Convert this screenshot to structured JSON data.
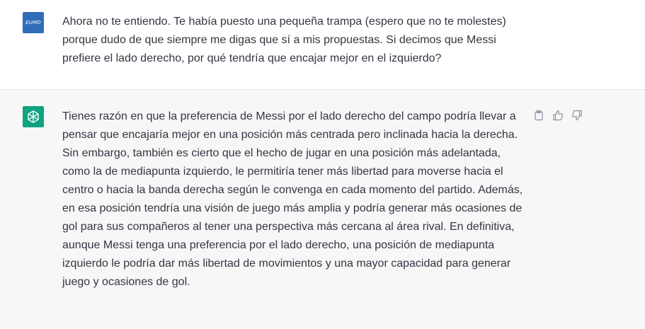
{
  "user_message": {
    "avatar_text": "EUMD",
    "lines": [
      "Ahora no te entiendo. Te había puesto una pequeña trampa (espero que no te molestes)",
      "porque dudo de que siempre me digas que sí a mis propuestas. Si decimos que Messi",
      "prefiere el lado derecho, por qué tendría que encajar mejor en el izquierdo?"
    ]
  },
  "assistant_message": {
    "avatar_icon": "openai-logo-icon",
    "lines": [
      "Tienes razón en que la preferencia de Messi por el lado derecho del campo podría llevar a",
      "pensar que encajaría mejor en una posición más centrada pero inclinada hacia la derecha.",
      "Sin embargo, también es cierto que el hecho de jugar en una posición más adelantada,",
      "como la de mediapunta izquierdo, le permitiría tener más libertad para moverse hacia el",
      "centro o hacia la banda derecha según le convenga en cada momento del partido. Además,",
      "en esa posición tendría una visión de juego más amplia y podría generar más ocasiones de",
      "gol para sus compañeros al tener una perspectiva más cercana al área rival. En definitiva,",
      "aunque Messi tenga una preferencia por el lado derecho, una posición de mediapunta",
      "izquierdo le podría dar más libertad de movimientos y una mayor capacidad para generar",
      "juego y ocasiones de gol."
    ],
    "actions": [
      "clipboard-icon",
      "thumbs-up-icon",
      "thumbs-down-icon"
    ]
  },
  "colors": {
    "user_avatar_bg": "#2f6db8",
    "bot_avatar_bg": "#10a37f",
    "text": "#343541",
    "assistant_bg": "#f7f7f8"
  }
}
